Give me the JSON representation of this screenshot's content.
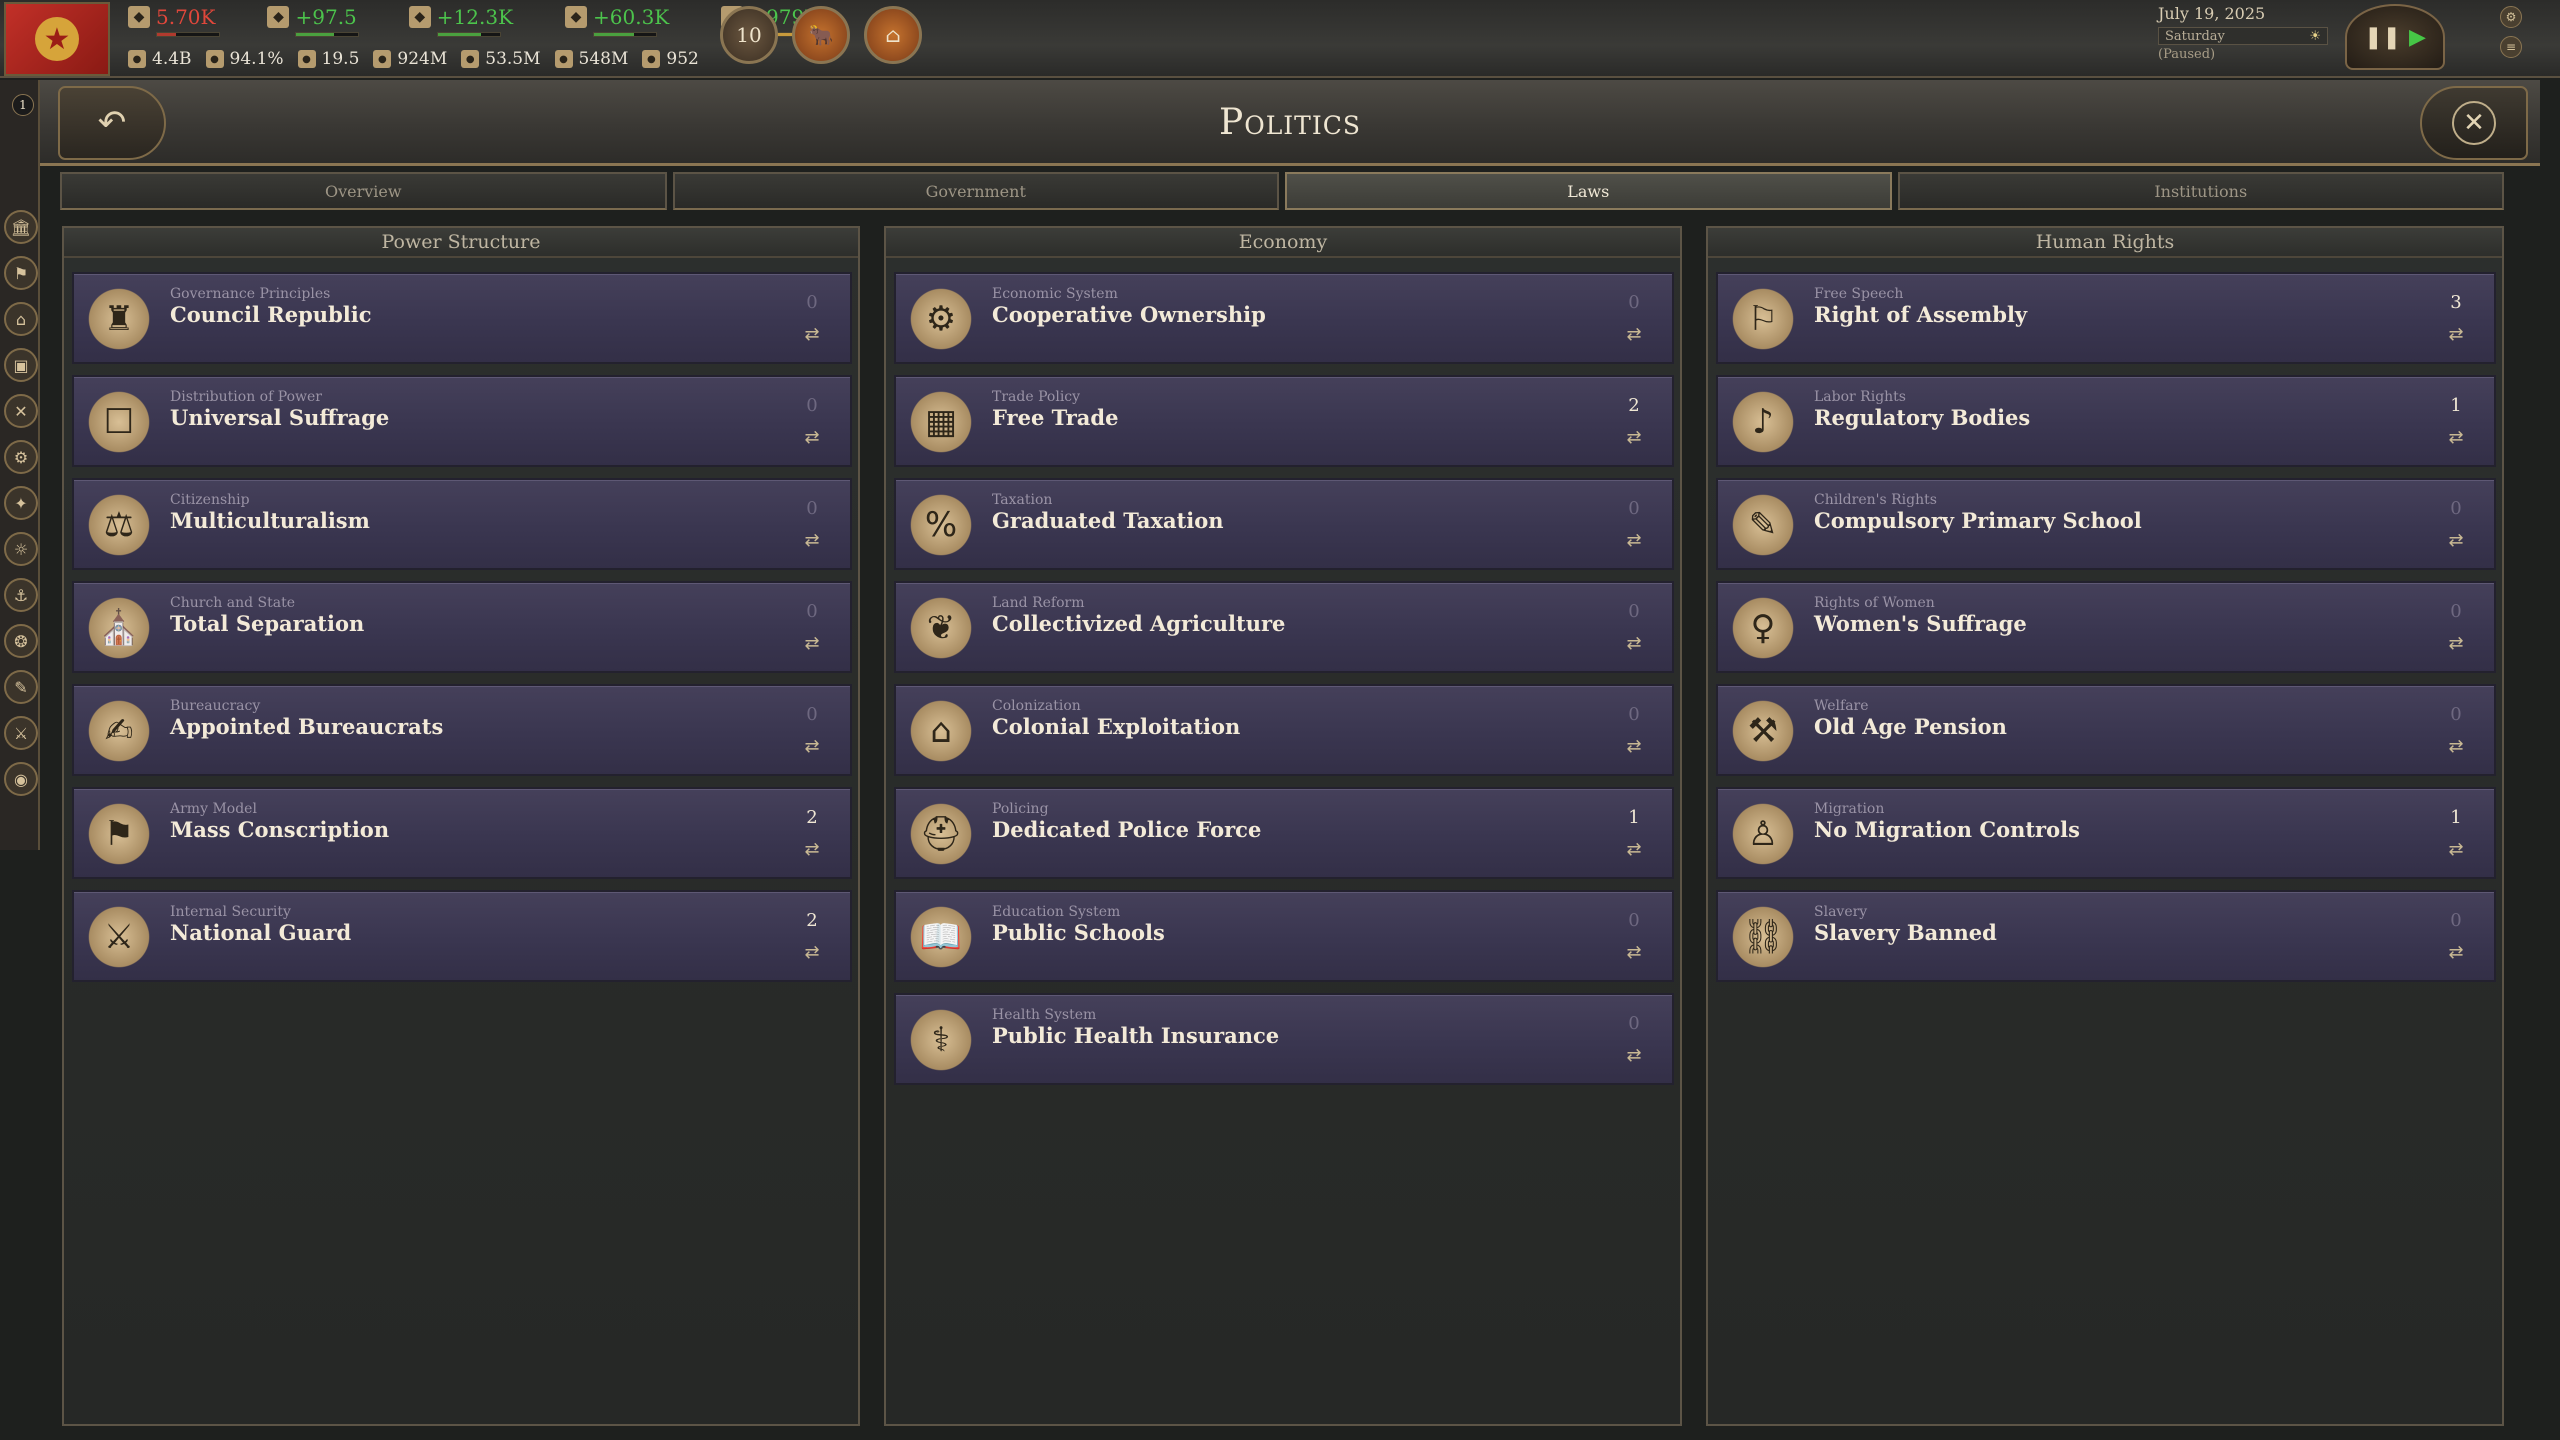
{
  "topbar": {
    "stats_top": [
      {
        "icon": "fist-icon",
        "value": "5.70K",
        "tone": "red",
        "fill": 0.3,
        "fillTone": "red"
      },
      {
        "icon": "heart-icon",
        "value": "+97.5",
        "tone": "green",
        "fill": 0.6,
        "fillTone": "green"
      },
      {
        "icon": "dove-icon",
        "value": "+12.3K",
        "tone": "green",
        "fill": 0.7,
        "fillTone": "green"
      },
      {
        "icon": "scroll-icon",
        "value": "+60.3K",
        "tone": "green",
        "fill": 0.65,
        "fillTone": "green"
      },
      {
        "icon": "pound-icon",
        "value": "+979K",
        "tone": "green",
        "fill": 0.8,
        "fillTone": "gold"
      }
    ],
    "stats_bottom": [
      {
        "icon": "prestige-icon",
        "value": "4.4B"
      },
      {
        "icon": "literacy-icon",
        "value": "94.1%"
      },
      {
        "icon": "stone-icon",
        "value": "19.5"
      },
      {
        "icon": "population-icon",
        "value": "924M"
      },
      {
        "icon": "workforce-icon",
        "value": "53.5M"
      },
      {
        "icon": "map-icon",
        "value": "548M"
      },
      {
        "icon": "wheat-icon",
        "value": "952"
      }
    ],
    "badges": [
      {
        "name": "influence-badge",
        "label": "10",
        "tone": "dark"
      },
      {
        "name": "journal-badge",
        "label": "🐂",
        "tone": "orange"
      },
      {
        "name": "market-badge",
        "label": "⌂",
        "tone": "orange"
      }
    ],
    "date": "July 19, 2025",
    "day": "Saturday",
    "paused": "(Paused)"
  },
  "leftstrip": {
    "queue_count": "1",
    "buttons": [
      "🏛",
      "⚑",
      "⌂",
      "▣",
      "✕",
      "⚙",
      "✦",
      "☼",
      "⚓",
      "❂",
      "✎",
      "⚔",
      "◉"
    ]
  },
  "panel": {
    "title": "Politics",
    "back_icon": "↶",
    "close_icon": "✕"
  },
  "tabs": [
    {
      "label": "Overview",
      "active": false
    },
    {
      "label": "Government",
      "active": false
    },
    {
      "label": "Laws",
      "active": true
    },
    {
      "label": "Institutions",
      "active": false
    }
  ],
  "columns": [
    {
      "title": "Power Structure",
      "laws": [
        {
          "category": "Governance Principles",
          "name": "Council Republic",
          "count": "0",
          "icon": "assembly-icon",
          "glyph": "♜"
        },
        {
          "category": "Distribution of Power",
          "name": "Universal Suffrage",
          "count": "0",
          "icon": "ballot-box-icon",
          "glyph": "☐"
        },
        {
          "category": "Citizenship",
          "name": "Multiculturalism",
          "count": "0",
          "icon": "scales-icon",
          "glyph": "⚖"
        },
        {
          "category": "Church and State",
          "name": "Total Separation",
          "count": "0",
          "icon": "church-icon",
          "glyph": "⛪"
        },
        {
          "category": "Bureaucracy",
          "name": "Appointed Bureaucrats",
          "count": "0",
          "icon": "quill-icon",
          "glyph": "✍"
        },
        {
          "category": "Army Model",
          "name": "Mass Conscription",
          "count": "2",
          "icon": "barracks-icon",
          "glyph": "⚑"
        },
        {
          "category": "Internal Security",
          "name": "National Guard",
          "count": "2",
          "icon": "soldiers-icon",
          "glyph": "⚔"
        }
      ]
    },
    {
      "title": "Economy",
      "laws": [
        {
          "category": "Economic System",
          "name": "Cooperative Ownership",
          "count": "0",
          "icon": "factory-icon",
          "glyph": "⚙"
        },
        {
          "category": "Trade Policy",
          "name": "Free Trade",
          "count": "2",
          "icon": "crate-icon",
          "glyph": "▦"
        },
        {
          "category": "Taxation",
          "name": "Graduated Taxation",
          "count": "0",
          "icon": "percent-icon",
          "glyph": "%"
        },
        {
          "category": "Land Reform",
          "name": "Collectivized Agriculture",
          "count": "0",
          "icon": "harvest-icon",
          "glyph": "❦"
        },
        {
          "category": "Colonization",
          "name": "Colonial Exploitation",
          "count": "0",
          "icon": "colonial-house-icon",
          "glyph": "⌂"
        },
        {
          "category": "Policing",
          "name": "Dedicated Police Force",
          "count": "1",
          "icon": "police-helmet-icon",
          "glyph": "⛑"
        },
        {
          "category": "Education System",
          "name": "Public Schools",
          "count": "0",
          "icon": "book-icon",
          "glyph": "📖"
        },
        {
          "category": "Health System",
          "name": "Public Health Insurance",
          "count": "0",
          "icon": "caduceus-icon",
          "glyph": "⚕"
        }
      ]
    },
    {
      "title": "Human Rights",
      "laws": [
        {
          "category": "Free Speech",
          "name": "Right of Assembly",
          "count": "3",
          "icon": "banners-icon",
          "glyph": "⚐"
        },
        {
          "category": "Labor Rights",
          "name": "Regulatory Bodies",
          "count": "1",
          "icon": "whistle-icon",
          "glyph": "♪"
        },
        {
          "category": "Children's Rights",
          "name": "Compulsory Primary School",
          "count": "0",
          "icon": "student-icon",
          "glyph": "✎"
        },
        {
          "category": "Rights of Women",
          "name": "Women's Suffrage",
          "count": "0",
          "icon": "venus-icon",
          "glyph": "♀"
        },
        {
          "category": "Welfare",
          "name": "Old Age Pension",
          "count": "0",
          "icon": "cane-icon",
          "glyph": "⚒"
        },
        {
          "category": "Migration",
          "name": "No Migration Controls",
          "count": "1",
          "icon": "traveler-icon",
          "glyph": "♙"
        },
        {
          "category": "Slavery",
          "name": "Slavery Banned",
          "count": "0",
          "icon": "broken-chain-icon",
          "glyph": "⛓"
        }
      ]
    }
  ],
  "colors": {
    "law_bg": "#3a3650",
    "accent_gold": "#8a7552",
    "positive": "#4cc44c",
    "negative": "#e0473b"
  }
}
